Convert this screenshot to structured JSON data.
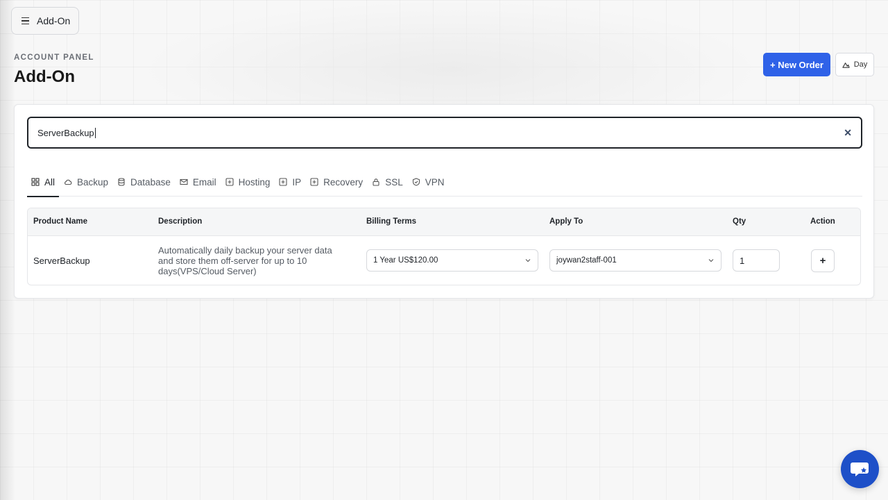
{
  "topbar": {
    "menu_label": "Add-On"
  },
  "header": {
    "eyebrow": "ACCOUNT PANEL",
    "title": "Add-On",
    "new_order_label": "+ New Order",
    "theme_label": "Day"
  },
  "search": {
    "value": "ServerBackup"
  },
  "tabs": [
    {
      "label": "All",
      "icon": "grid-icon",
      "active": true
    },
    {
      "label": "Backup",
      "icon": "cloud-icon"
    },
    {
      "label": "Database",
      "icon": "database-icon"
    },
    {
      "label": "Email",
      "icon": "mail-icon"
    },
    {
      "label": "Hosting",
      "icon": "plus-square-icon"
    },
    {
      "label": "IP",
      "icon": "plus-square-icon"
    },
    {
      "label": "Recovery",
      "icon": "plus-square-icon"
    },
    {
      "label": "SSL",
      "icon": "lock-icon"
    },
    {
      "label": "VPN",
      "icon": "shield-icon"
    }
  ],
  "table": {
    "headers": {
      "product": "Product Name",
      "description": "Description",
      "billing": "Billing Terms",
      "apply_to": "Apply To",
      "qty": "Qty",
      "action": "Action"
    },
    "rows": [
      {
        "product": "ServerBackup",
        "description": "Automatically daily backup your server data and store them off-server for up to 10 days(VPS/Cloud Server)",
        "billing": "1 Year US$120.00",
        "apply_to": "joywan2staff-001",
        "qty": "1",
        "action": "+"
      }
    ]
  },
  "colors": {
    "primary": "#2f62e8",
    "chat": "#1e50c8"
  }
}
